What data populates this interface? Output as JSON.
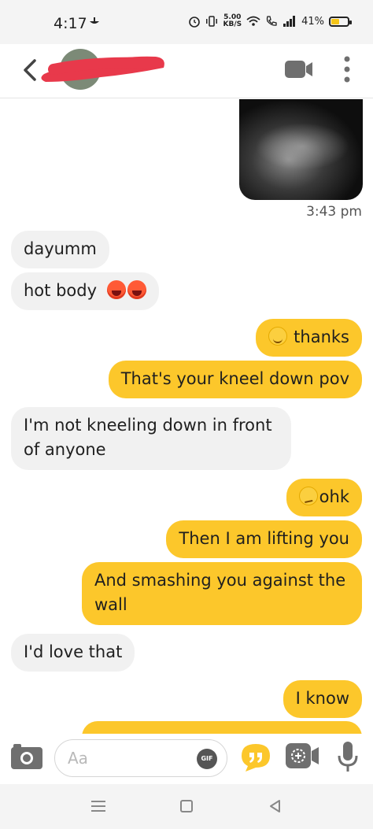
{
  "status_bar": {
    "time": "4:17",
    "network_speed_value": "5.00",
    "network_speed_unit": "KB/S",
    "battery": "41%",
    "icons": [
      "notification-icon",
      "alarm-icon",
      "vibrate-icon",
      "wifi-icon",
      "call-icon",
      "signal-icon",
      "battery-icon"
    ]
  },
  "header": {
    "icons": [
      "back-icon",
      "avatar",
      "video-call-icon",
      "more-options-icon"
    ]
  },
  "chat": {
    "photo_timestamp": "3:43 pm",
    "messages": [
      {
        "side": "in",
        "text": "dayumm"
      },
      {
        "side": "in",
        "text": "hot body",
        "emoji": [
          "hot-face-icon",
          "hot-face-icon"
        ]
      },
      {
        "side": "out",
        "text": "thanks",
        "emoji_before": "relieved-face-icon"
      },
      {
        "side": "out",
        "text": "That's your kneel down pov"
      },
      {
        "side": "in",
        "line1": "I'm not kneeling down in front",
        "line2": "of anyone"
      },
      {
        "side": "out",
        "text": "ohk",
        "emoji_before": "smirk-face-icon"
      },
      {
        "side": "out",
        "text": "Then I am lifting you"
      },
      {
        "side": "out",
        "line1": "And smashing you against the",
        "line2": "wall"
      },
      {
        "side": "in",
        "text": "I'd love that"
      },
      {
        "side": "out",
        "text": "I know"
      }
    ]
  },
  "composer": {
    "placeholder": "Aa",
    "gif_label": "GIF",
    "icons": [
      "camera-icon",
      "gif-icon",
      "quote-icon",
      "video-message-icon",
      "microphone-icon"
    ]
  },
  "colors": {
    "outgoing_bubble": "#fcc72b",
    "incoming_bubble": "#f1f1f1",
    "redaction": "#e8394b"
  }
}
